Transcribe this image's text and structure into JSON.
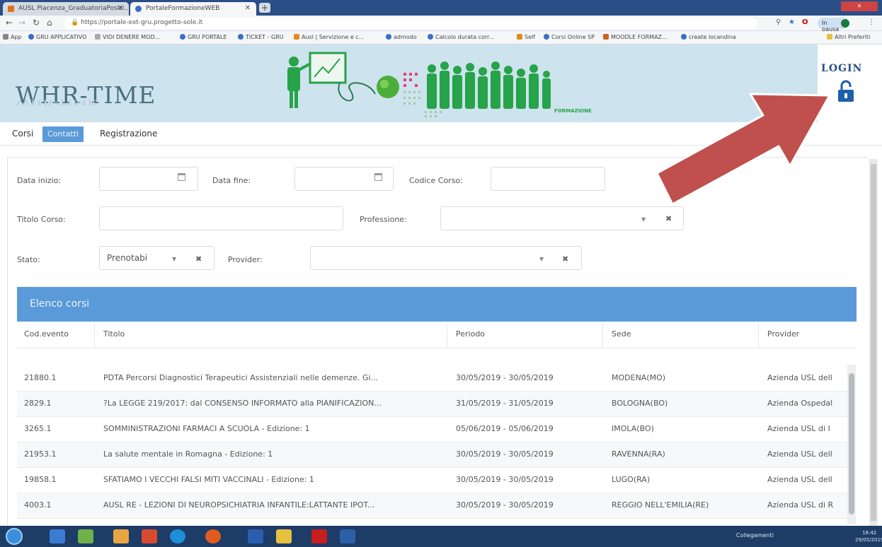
{
  "browser": {
    "tabs": [
      {
        "title": "AUSL Piacenza_GraduatoriaPosizi..."
      },
      {
        "title": "PortaleFormazioneWEB"
      }
    ],
    "new_tab": "+",
    "url": "https://portale-ext-gru.progetto-sole.it",
    "user": "In pausa",
    "bookmarks": [
      "App",
      "GRU APPLICATIVO",
      "VIDI DENERE MOD...",
      "GRU PORTALE",
      "TICKET - GRU",
      "Ausl | Servizione e c...",
      "admodo",
      "Calcolo durata corr...",
      "Self",
      "Corsi Online SP",
      "MOODLE FORMAZ...",
      "create locandina",
      "Altri Preferiti"
    ]
  },
  "header": {
    "brand": "WHR-TIME",
    "sub_brand": "FORMAZIONE",
    "login_label": "LOGIN"
  },
  "nav": {
    "items": [
      {
        "label": "Corsi"
      },
      {
        "label": "Contatti"
      },
      {
        "label": "Registrazione"
      }
    ]
  },
  "filters": {
    "data_inizio_label": "Data inizio:",
    "data_fine_label": "Data fine:",
    "codice_corso_label": "Codice Corso:",
    "titolo_corso_label": "Titolo Corso:",
    "professione_label": "Professione:",
    "stato_label": "Stato:",
    "stato_value": "Prenotabi",
    "provider_label": "Provider:"
  },
  "list": {
    "title": "Elenco corsi",
    "columns": [
      "Cod.evento",
      "Titolo",
      "Periodo",
      "Sede",
      "Provider"
    ],
    "rows": [
      {
        "cod": "21880.1",
        "titolo": "PDTA Percorsi Diagnostici Terapeutici Assistenziali nelle demenze. Gi...",
        "periodo": "30/05/2019 - 30/05/2019",
        "sede": "MODENA(MO)",
        "provider": "Azienda USL dell"
      },
      {
        "cod": "2829.1",
        "titolo": "?La LEGGE 219/2017: dal CONSENSO INFORMATO alla PIANIFICAZION...",
        "periodo": "31/05/2019 - 31/05/2019",
        "sede": "BOLOGNA(BO)",
        "provider": "Azienda Ospedal"
      },
      {
        "cod": "3265.1",
        "titolo": "SOMMINISTRAZIONI FARMACI A SCUOLA - Edizione: 1",
        "periodo": "05/06/2019 - 05/06/2019",
        "sede": "IMOLA(BO)",
        "provider": "Azienda USL di I"
      },
      {
        "cod": "21953.1",
        "titolo": "La salute mentale in Romagna - Edizione: 1",
        "periodo": "30/05/2019 - 30/05/2019",
        "sede": "RAVENNA(RA)",
        "provider": "Azienda USL dell"
      },
      {
        "cod": "19858.1",
        "titolo": "SFATIAMO I VECCHI FALSI MITI VACCINALI - Edizione: 1",
        "periodo": "30/05/2019 - 30/05/2019",
        "sede": "LUGO(RA)",
        "provider": "Azienda USL dell"
      },
      {
        "cod": "4003.1",
        "titolo": "AUSL RE - LEZIONI DI NEUROPSICHIATRIA INFANTILE:LATTANTE IPOT...",
        "periodo": "30/05/2019 - 30/05/2019",
        "sede": "REGGIO NELL'EMILIA(RE)",
        "provider": "Azienda USL di R"
      }
    ]
  },
  "taskbar": {
    "tray_label": "Collegamenti",
    "time": "18:42",
    "date": "29/05/2019"
  },
  "colors": {
    "accent": "#5b9ad8",
    "banner": "#cde3ee",
    "brand_text": "#4a6f7e",
    "login_blue": "#2b4e86",
    "arrow_red": "#c0504d",
    "figure_green": "#27a34a"
  },
  "icons": [
    "calendar-icon",
    "chevron-down-icon",
    "close-icon",
    "lock-open-icon",
    "arrow-annotation-icon",
    "windows-start-icon"
  ]
}
